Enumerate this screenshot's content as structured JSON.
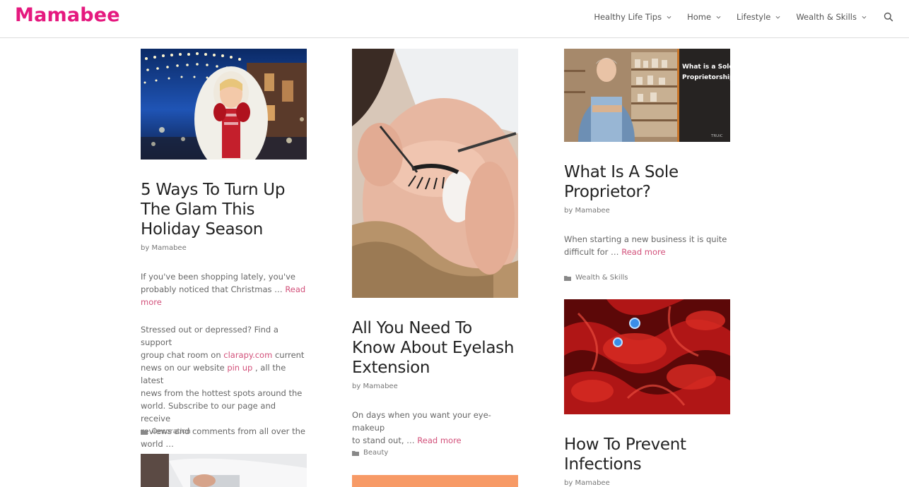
{
  "site": {
    "logo": "Mamabee"
  },
  "nav": {
    "items": [
      {
        "label": "Healthy Life Tips"
      },
      {
        "label": "Home"
      },
      {
        "label": "Lifestyle"
      },
      {
        "label": "Wealth & Skills"
      }
    ],
    "search_icon": "search-icon"
  },
  "posts": [
    {
      "title_lines": [
        "5 Ways To Turn Up",
        "The Glam This",
        "Holiday Season"
      ],
      "byline": "by Mamabee",
      "excerpt_lines": [
        "If you've been shopping lately, you've",
        "probably noticed that Christmas … "
      ],
      "read_more_a": "Read",
      "read_more_b": "more",
      "extra": {
        "l1a": "Stressed out or depressed? Find a support",
        "l2a": "group chat room on ",
        "l2link": "clarapy.com",
        "l2b": " current",
        "l3a": "news on our website ",
        "l3link": "pin up",
        "l3b": " , all the latest",
        "l4": "news from the hottest spots around the",
        "l5": "world. Subscribe to our page and receive",
        "l6": "reviews and comments from all over the",
        "l7": "world …"
      },
      "category": "Decoration"
    },
    {
      "title_lines": [
        "All You Need To",
        "Know About Eyelash",
        "Extension"
      ],
      "byline": "by Mamabee",
      "excerpt_lines": [
        "On days when you want your eye-makeup",
        "to stand out, … "
      ],
      "read_more": "Read more",
      "category": "Beauty"
    },
    {
      "thumb_text_1": "What is a Sole",
      "thumb_text_2": "Proprietorship?",
      "thumb_brand": "TRUiC",
      "title_lines": [
        "What Is A Sole",
        "Proprietor?"
      ],
      "byline": "by Mamabee",
      "excerpt_lines": [
        "When starting a new business it is quite",
        "difficult for … "
      ],
      "read_more": "Read more",
      "category": "Wealth & Skills"
    },
    {
      "title_lines": [
        "How To Prevent",
        "Infections"
      ],
      "byline": "by Mamabee"
    }
  ],
  "colors": {
    "brand": "#e5197f",
    "link": "#d2507a",
    "orange_thumb": "#f79a66"
  }
}
